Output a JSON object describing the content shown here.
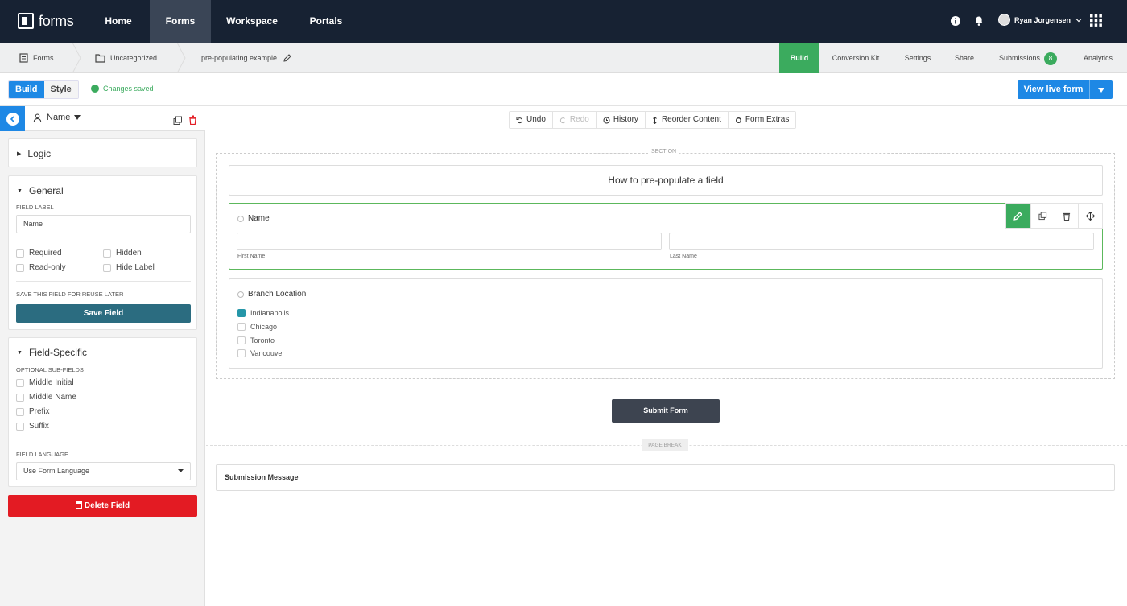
{
  "topnav": {
    "logo_text": "forms",
    "items": [
      "Home",
      "Forms",
      "Workspace",
      "Portals"
    ],
    "active": "Forms",
    "user_name": "Ryan Jorgensen"
  },
  "breadcrumb": {
    "items": [
      "Forms",
      "Uncategorized",
      "pre-populating example"
    ]
  },
  "right_tabs": {
    "build": "Build",
    "conversion_kit": "Conversion Kit",
    "settings": "Settings",
    "share": "Share",
    "submissions": "Submissions",
    "submissions_count": "8",
    "analytics": "Analytics"
  },
  "mode": {
    "build": "Build",
    "style": "Style",
    "status": "Changes saved"
  },
  "view_live_form": "View live form",
  "left_panel": {
    "field_selector": "Name",
    "logic": {
      "title": "Logic"
    },
    "general": {
      "title": "General",
      "field_label_caption": "FIELD LABEL",
      "field_label_value": "Name",
      "options": [
        "Required",
        "Hidden",
        "Read-only",
        "Hide Label"
      ],
      "save_caption": "SAVE THIS FIELD FOR REUSE LATER",
      "save_button": "Save Field"
    },
    "field_specific": {
      "title": "Field-Specific",
      "subfields_caption": "OPTIONAL SUB-FIELDS",
      "subfields": [
        "Middle Initial",
        "Middle Name",
        "Prefix",
        "Suffix"
      ],
      "language_caption": "FIELD LANGUAGE",
      "language_value": "Use Form Language"
    },
    "delete_button": "Delete Field"
  },
  "canvas_toolbar": {
    "undo": "Undo",
    "redo": "Redo",
    "history": "History",
    "reorder": "Reorder Content",
    "extras": "Form Extras"
  },
  "form": {
    "section_label": "SECTION",
    "heading": "How to pre-populate a field",
    "name_field": {
      "label": "Name",
      "first_caption": "First Name",
      "last_caption": "Last Name"
    },
    "branch_field": {
      "label": "Branch Location",
      "options": [
        "Indianapolis",
        "Chicago",
        "Toronto",
        "Vancouver"
      ],
      "checked": "Indianapolis"
    },
    "submit_button": "Submit Form",
    "page_break_label": "PAGE BREAK",
    "submission_message": "Submission Message"
  },
  "colors": {
    "nav_bg": "#172233",
    "accent_blue": "#1e88e5",
    "accent_green": "#3bab5e",
    "teal": "#2b6c80",
    "danger": "#e31b23"
  }
}
